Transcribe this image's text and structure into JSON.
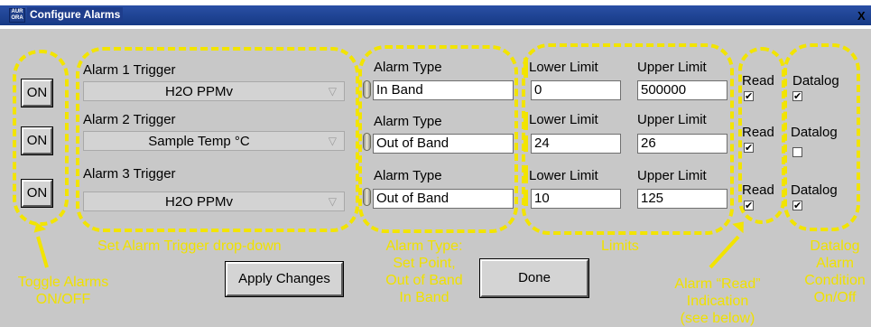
{
  "window": {
    "title": "Configure Alarms",
    "close_glyph": "X"
  },
  "alarms": [
    {
      "toggle": "ON",
      "trigger_label": "Alarm 1 Trigger",
      "trigger_value": "H2O PPMv",
      "type_label": "Alarm Type",
      "type_value": "In Band",
      "lower_label": "Lower Limit",
      "lower_value": "0",
      "upper_label": "Upper Limit",
      "upper_value": "500000",
      "read_label": "Read",
      "datalog_label": "Datalog",
      "read_checked": true,
      "datalog_checked": true
    },
    {
      "toggle": "ON",
      "trigger_label": "Alarm 2 Trigger",
      "trigger_value": "Sample Temp °C",
      "type_label": "Alarm Type",
      "type_value": "Out of Band",
      "lower_label": "Lower Limit",
      "lower_value": "24",
      "upper_label": "Upper Limit",
      "upper_value": "26",
      "read_label": "Read",
      "datalog_label": "Datalog",
      "read_checked": true,
      "datalog_checked": false
    },
    {
      "toggle": "ON",
      "trigger_label": "Alarm 3 Trigger",
      "trigger_value": "H2O PPMv",
      "type_label": "Alarm Type",
      "type_value": "Out of Band",
      "lower_label": "Lower Limit",
      "lower_value": "10",
      "upper_label": "Upper Limit",
      "upper_value": "125",
      "read_label": "Read",
      "datalog_label": "Datalog",
      "read_checked": true,
      "datalog_checked": true
    }
  ],
  "buttons": {
    "apply": "Apply Changes",
    "done": "Done"
  },
  "annotations": {
    "toggle": [
      "Toggle Alarms",
      "ON/OFF"
    ],
    "trigger": "Set Alarm Trigger drop-down",
    "type": [
      "Alarm Type:",
      "Set Point,",
      "Out of Band",
      "In Band"
    ],
    "limits": "Limits",
    "read": [
      "Alarm “Read”",
      "Indication",
      "(see below)"
    ],
    "datalog": [
      "Datalog",
      "Alarm",
      "Condition",
      "On/Off"
    ]
  },
  "colors": {
    "annotation": "#f2e400",
    "titlebar": "#1e3d8c",
    "window_bg": "#c8c8c8"
  }
}
